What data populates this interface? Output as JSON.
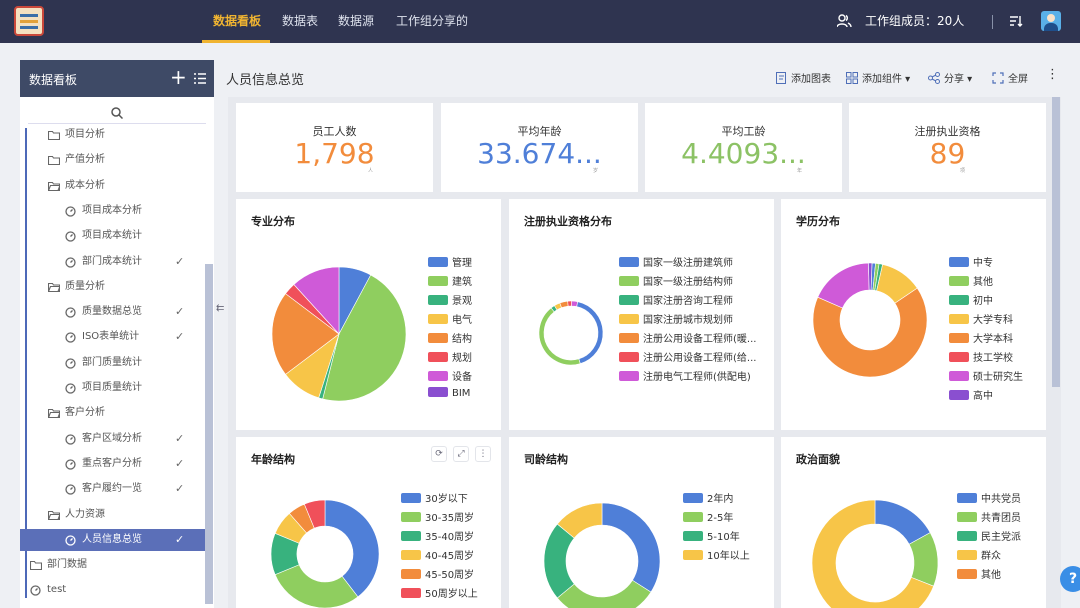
{
  "topbar": {
    "nav": [
      "数据看板",
      "数据表",
      "数据源",
      "工作组分享的"
    ],
    "members": "工作组成员：20人"
  },
  "sidebar": {
    "title": "数据看板",
    "items": [
      {
        "label": "项目分析",
        "type": "folder",
        "level": 1
      },
      {
        "label": "产值分析",
        "type": "folder",
        "level": 1
      },
      {
        "label": "成本分析",
        "type": "folder-open",
        "level": 1
      },
      {
        "label": "项目成本分析",
        "type": "board",
        "level": 2
      },
      {
        "label": "项目成本统计",
        "type": "board",
        "level": 2
      },
      {
        "label": "部门成本统计",
        "type": "board",
        "level": 2,
        "checked": true
      },
      {
        "label": "质量分析",
        "type": "folder-open",
        "level": 1
      },
      {
        "label": "质量数据总览",
        "type": "board",
        "level": 2,
        "checked": true
      },
      {
        "label": "ISO表单统计",
        "type": "board",
        "level": 2,
        "checked": true
      },
      {
        "label": "部门质量统计",
        "type": "board",
        "level": 2
      },
      {
        "label": "项目质量统计",
        "type": "board",
        "level": 2
      },
      {
        "label": "客户分析",
        "type": "folder-open",
        "level": 1
      },
      {
        "label": "客户区域分析",
        "type": "board",
        "level": 2,
        "checked": true
      },
      {
        "label": "重点客户分析",
        "type": "board",
        "level": 2,
        "checked": true
      },
      {
        "label": "客户履约一览",
        "type": "board",
        "level": 2,
        "checked": true
      },
      {
        "label": "人力资源",
        "type": "folder-open",
        "level": 1
      },
      {
        "label": "人员信息总览",
        "type": "board",
        "level": 2,
        "checked": true,
        "active": true
      },
      {
        "label": "部门数据",
        "type": "folder",
        "level": 0
      },
      {
        "label": "test",
        "type": "board",
        "level": 0
      }
    ]
  },
  "page": {
    "title": "人员信息总览"
  },
  "toolbar": {
    "add_chart": "添加图表",
    "add_widget": "添加组件",
    "share": "分享",
    "fullscreen": "全屏"
  },
  "kpis": [
    {
      "label": "员工人数",
      "value": "1,798",
      "unit": "人",
      "color": "#f28c3c"
    },
    {
      "label": "平均年龄",
      "value": "33.674...",
      "unit": "岁",
      "color": "#4f7fd8"
    },
    {
      "label": "平均工龄",
      "value": "4.4093...",
      "unit": "年",
      "color": "#8cc265"
    },
    {
      "label": "注册执业资格",
      "value": "89",
      "unit": "项",
      "color": "#f28c3c"
    }
  ],
  "charts": [
    {
      "title": "专业分布"
    },
    {
      "title": "注册执业资格分布"
    },
    {
      "title": "学历分布"
    },
    {
      "title": "年龄结构"
    },
    {
      "title": "司龄结构"
    },
    {
      "title": "政治面貌"
    }
  ],
  "chart_data": [
    {
      "type": "pie",
      "title": "专业分布",
      "categories": [
        "管理",
        "建筑",
        "景观",
        "电气",
        "结构",
        "规划",
        "设备",
        "BIM"
      ],
      "values": [
        8,
        47,
        1,
        10,
        21,
        3,
        12,
        0
      ],
      "colors": [
        "#4f7fd8",
        "#8fce5f",
        "#38b27e",
        "#f7c548",
        "#f28c3c",
        "#f0505a",
        "#cf5ad8",
        "#8a4fd0"
      ]
    },
    {
      "type": "donut",
      "title": "注册执业资格分布",
      "categories": [
        "国家一级注册建筑师",
        "国家一级注册结构师",
        "国家注册咨询工程师",
        "国家注册城市规划师",
        "注册公用设备工程师(暖...",
        "注册公用设备工程师(给...",
        "注册电气工程师(供配电)"
      ],
      "values": [
        42,
        44,
        2,
        3,
        4,
        2,
        3
      ],
      "colors": [
        "#4f7fd8",
        "#8fce5f",
        "#38b27e",
        "#f7c548",
        "#f28c3c",
        "#f0505a",
        "#cf5ad8"
      ]
    },
    {
      "type": "donut",
      "title": "学历分布",
      "categories": [
        "中专",
        "其他",
        "初中",
        "大学专科",
        "大学本科",
        "技工学校",
        "硕士研究生",
        "高中"
      ],
      "values": [
        1,
        1,
        1,
        12,
        66,
        0,
        18,
        1
      ],
      "colors": [
        "#4f7fd8",
        "#8fce5f",
        "#38b27e",
        "#f7c548",
        "#f28c3c",
        "#f0505a",
        "#cf5ad8",
        "#8a4fd0"
      ]
    },
    {
      "type": "donut",
      "title": "年龄结构",
      "categories": [
        "30岁以下",
        "30-35周岁",
        "35-40周岁",
        "40-45周岁",
        "45-50周岁",
        "50周岁以上"
      ],
      "values": [
        38,
        28,
        12,
        7,
        5,
        6
      ],
      "colors": [
        "#4f7fd8",
        "#8fce5f",
        "#38b27e",
        "#f7c548",
        "#f28c3c",
        "#f0505a"
      ]
    },
    {
      "type": "donut",
      "title": "司龄结构",
      "categories": [
        "2年内",
        "2-5年",
        "5-10年",
        "10年以上"
      ],
      "values": [
        34,
        30,
        22,
        14
      ],
      "colors": [
        "#4f7fd8",
        "#8fce5f",
        "#38b27e",
        "#f7c548"
      ]
    },
    {
      "type": "donut",
      "title": "政治面貌",
      "categories": [
        "中共党员",
        "共青团员",
        "民主党派",
        "群众",
        "其他"
      ],
      "values": [
        17,
        14,
        0,
        69,
        0
      ],
      "colors": [
        "#4f7fd8",
        "#8fce5f",
        "#38b27e",
        "#f7c548",
        "#f28c3c"
      ]
    }
  ]
}
